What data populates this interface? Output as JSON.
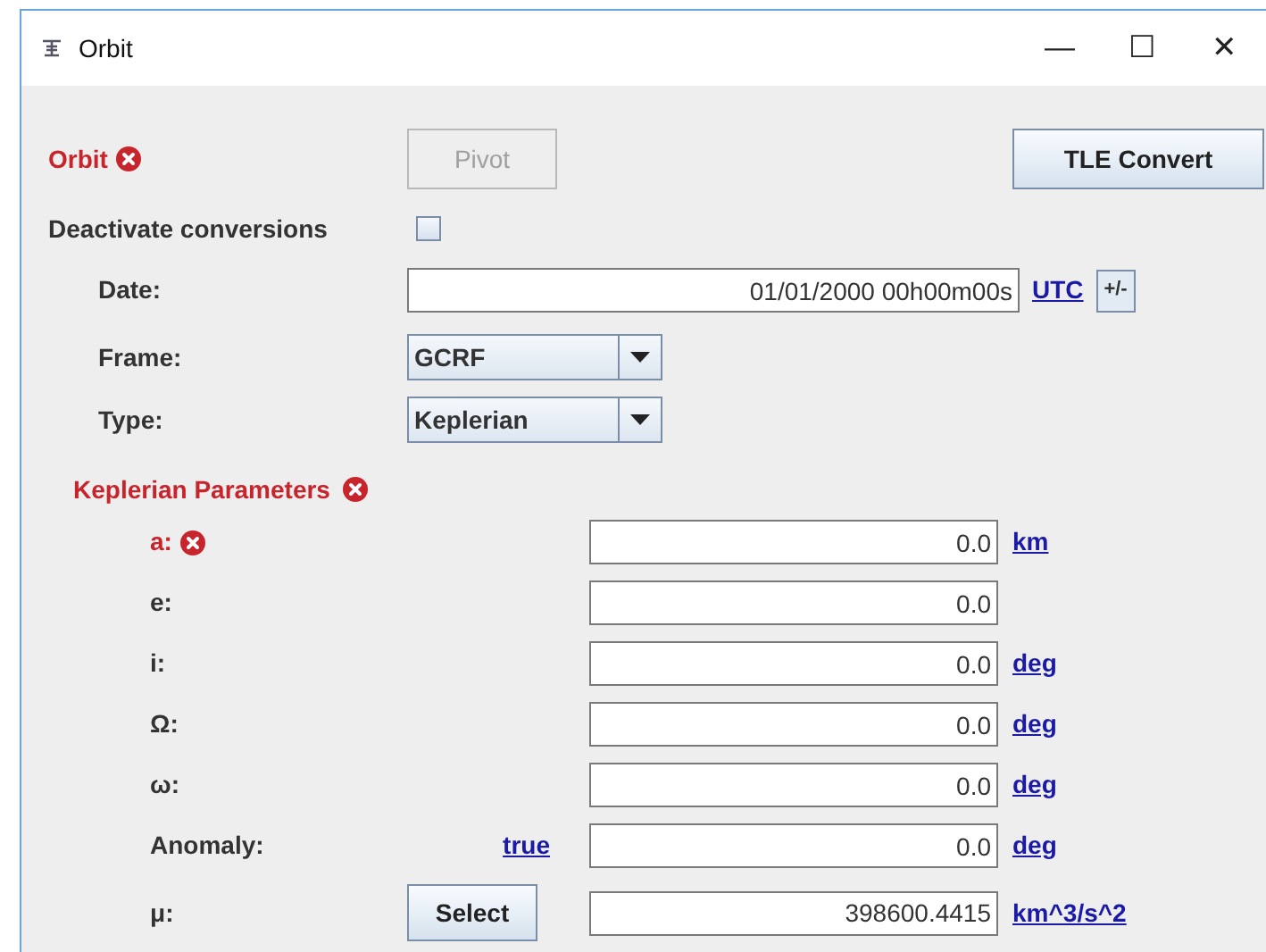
{
  "window": {
    "title": "Orbit",
    "controls": [
      "—",
      "☐",
      "✕"
    ]
  },
  "header": {
    "label": "Orbit",
    "error": true,
    "pivot": {
      "label": "Pivot",
      "disabled": true
    },
    "tle": {
      "label": "TLE Convert"
    }
  },
  "deactivate": {
    "label": "Deactivate conversions",
    "checked": false
  },
  "date": {
    "label": "Date:",
    "value": "01/01/2000 00h00m00s",
    "link": "UTC",
    "button": "+/-"
  },
  "frame": {
    "label": "Frame:",
    "value": "GCRF"
  },
  "type": {
    "label": "Type:",
    "value": "Keplerian"
  },
  "parameters": {
    "title": "Keplerian Parameters",
    "error": true,
    "rows": [
      {
        "label": "a:",
        "error": true,
        "value": "0.0",
        "unit": "km"
      },
      {
        "label": "e:",
        "error": false,
        "value": "0.0"
      },
      {
        "label": "i:",
        "error": false,
        "value": "0.0",
        "unit": "deg"
      },
      {
        "label": "Ω:",
        "error": false,
        "value": "0.0",
        "unit": "deg"
      },
      {
        "label": "ω:",
        "error": false,
        "value": "0.0",
        "unit": "deg"
      },
      {
        "label": "Anomaly:",
        "error": false,
        "kind": "link",
        "action": "true",
        "value": "0.0",
        "unit": "deg"
      },
      {
        "label": "μ:",
        "error": false,
        "kind": "button",
        "action": "Select",
        "value": "398600.4415",
        "unit": "km^3/s^2"
      }
    ]
  }
}
